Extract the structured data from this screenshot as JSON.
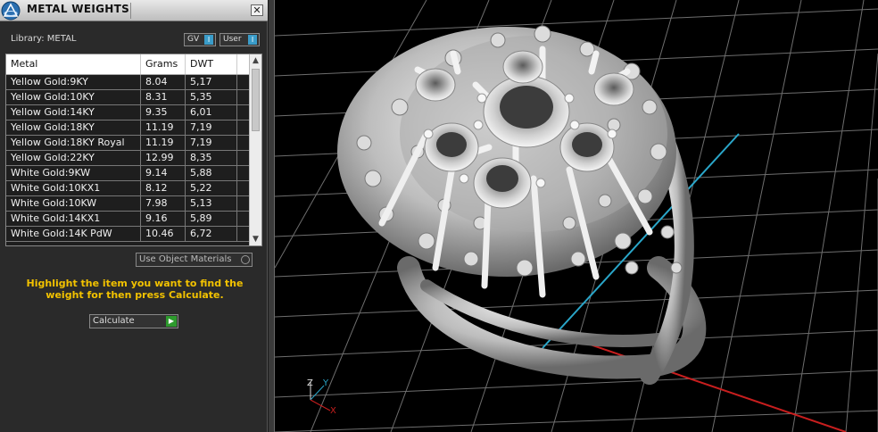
{
  "panel": {
    "title": "METAL WEIGHTS",
    "close_label": "✕",
    "library_label": "Library: METAL",
    "toggles": [
      {
        "label": "GV",
        "value": "I"
      },
      {
        "label": "User",
        "value": "I"
      }
    ],
    "table": {
      "headers": [
        "Metal",
        "Grams",
        "DWT"
      ],
      "rows": [
        [
          "Yellow Gold:9KY",
          "8.04",
          "5,17"
        ],
        [
          "Yellow Gold:10KY",
          "8.31",
          "5,35"
        ],
        [
          "Yellow Gold:14KY",
          "9.35",
          "6,01"
        ],
        [
          "Yellow Gold:18KY",
          "11.19",
          "7,19"
        ],
        [
          "Yellow Gold:18KY Royal",
          "11.19",
          "7,19"
        ],
        [
          "Yellow Gold:22KY",
          "12.99",
          "8,35"
        ],
        [
          "White Gold:9KW",
          "9.14",
          "5,88"
        ],
        [
          "White Gold:10KX1",
          "8.12",
          "5,22"
        ],
        [
          "White Gold:10KW",
          "7.98",
          "5,13"
        ],
        [
          "White Gold:14KX1",
          "9.16",
          "5,89"
        ],
        [
          "White Gold:14K PdW",
          "10.46",
          "6,72"
        ]
      ]
    },
    "use_object_materials": "Use Object Materials",
    "instructions": "Highlight the item you want to find the weight for then press Calculate.",
    "calculate_label": "Calculate"
  },
  "viewport": {
    "axis_labels": {
      "z": "Z",
      "y": "Y",
      "x": "X"
    }
  }
}
